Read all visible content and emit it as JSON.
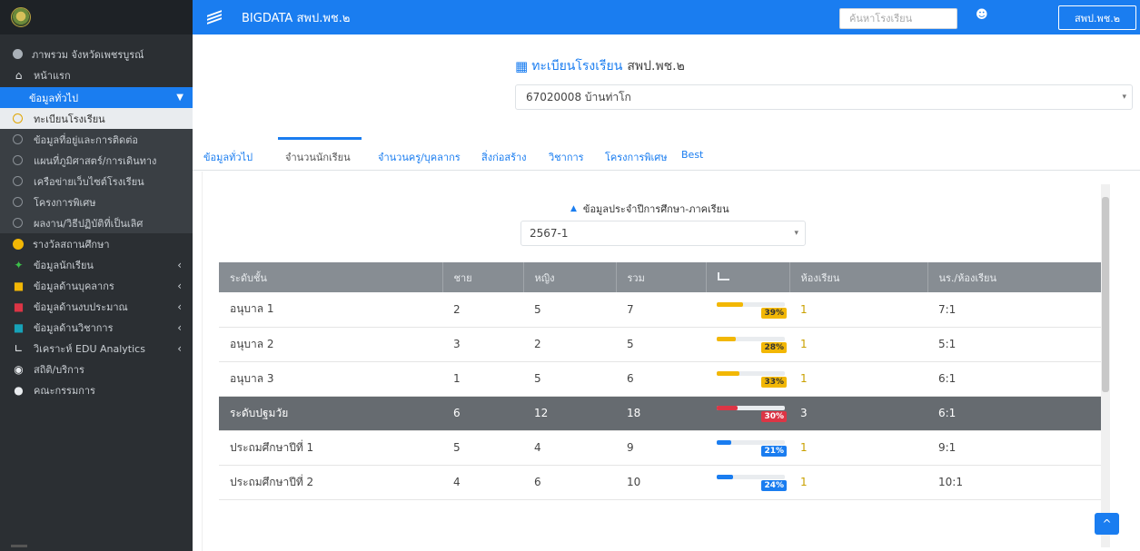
{
  "header": {
    "app_title": "BIGDATA สพป.พช.๒",
    "search_placeholder": "ค้นหาโรงเรียน",
    "user_label": "สพป.พช.๒"
  },
  "sidebar": {
    "items": [
      {
        "label": "ภาพรวม จังหวัดเพชรบูรณ์",
        "icon": "globe-icon",
        "color": "#a9b0b7"
      },
      {
        "label": "หน้าแรก",
        "icon": "home-icon",
        "color": "#dfe3e7"
      }
    ],
    "active_group": "ข้อมูลทั่วไป",
    "sub_items": [
      {
        "label": "ทะเบียนโรงเรียน",
        "current": true
      },
      {
        "label": "ข้อมูลที่อยู่และการติดต่อ"
      },
      {
        "label": "แผนที่ภูมิศาสตร์/การเดินทาง"
      },
      {
        "label": "เครือข่ายเว็บไซต์โรงเรียน"
      },
      {
        "label": "โครงการพิเศษ"
      },
      {
        "label": "ผลงาน/วิธีปฏิบัติที่เป็นเลิศ"
      }
    ],
    "groups": [
      {
        "label": "รางวัลสถานศึกษา",
        "icon": "award-icon",
        "color": "#f2b705",
        "expandable": false
      },
      {
        "label": "ข้อมูลนักเรียน",
        "icon": "student-icon",
        "color": "#3cbf4a",
        "expandable": true
      },
      {
        "label": "ข้อมูลด้านบุคลากร",
        "icon": "staff-icon",
        "color": "#f2b705",
        "expandable": true
      },
      {
        "label": "ข้อมูลด้านงบประมาณ",
        "icon": "budget-icon",
        "color": "#dc3545",
        "expandable": true
      },
      {
        "label": "ข้อมูลด้านวิชาการ",
        "icon": "academic-icon",
        "color": "#17a2b8",
        "expandable": true
      },
      {
        "label": "วิเคราะห์ EDU Analytics",
        "icon": "chart-icon",
        "color": "#e9ecef",
        "expandable": true
      },
      {
        "label": "สถิติ/บริการ",
        "icon": "eye-icon",
        "color": "#e9ecef",
        "expandable": false
      },
      {
        "label": "คณะกรรมการ",
        "icon": "users-icon",
        "color": "#e9ecef",
        "expandable": false
      }
    ]
  },
  "main": {
    "page_title_prefix": "ทะเบียนโรงเรียน",
    "page_title_suffix": "สพป.พช.๒",
    "school_selected": "67020008 บ้านท่าโก",
    "tabs": [
      "ข้อมูลทั่วไป",
      "จำนวนนักเรียน",
      "จำนวนครู/บุคลากร",
      "สิ่งก่อสร้าง",
      "วิชาการ",
      "โครงการพิเศษ",
      "Best"
    ],
    "active_tab": "จำนวนนักเรียน",
    "panel_title": "ข้อมูลประจำปีการศึกษา-ภาคเรียน",
    "term_selected": "2567-1",
    "table": {
      "headers": [
        "ระดับชั้น",
        "ชาย",
        "หญิง",
        "รวม",
        "",
        "ห้องเรียน",
        "นร./ห้องเรียน"
      ],
      "rows": [
        {
          "level": "อนุบาล 1",
          "male": "2",
          "female": "5",
          "total": "7",
          "pct": 39,
          "pct_label": "39%",
          "color": "yellow",
          "rooms": "1",
          "ratio": "7:1"
        },
        {
          "level": "อนุบาล 2",
          "male": "3",
          "female": "2",
          "total": "5",
          "pct": 28,
          "pct_label": "28%",
          "color": "yellow",
          "rooms": "1",
          "ratio": "5:1"
        },
        {
          "level": "อนุบาล 3",
          "male": "1",
          "female": "5",
          "total": "6",
          "pct": 33,
          "pct_label": "33%",
          "color": "yellow",
          "rooms": "1",
          "ratio": "6:1"
        },
        {
          "level": "ระดับปฐมวัย",
          "male": "6",
          "female": "12",
          "total": "18",
          "pct": 30,
          "pct_label": "30%",
          "color": "red",
          "rooms": "3",
          "ratio": "6:1",
          "summary": true
        },
        {
          "level": "ประถมศึกษาปีที่ 1",
          "male": "5",
          "female": "4",
          "total": "9",
          "pct": 21,
          "pct_label": "21%",
          "color": "blue",
          "rooms": "1",
          "ratio": "9:1"
        },
        {
          "level": "ประถมศึกษาปีที่ 2",
          "male": "4",
          "female": "6",
          "total": "10",
          "pct": 24,
          "pct_label": "24%",
          "color": "blue",
          "rooms": "1",
          "ratio": "10:1"
        }
      ]
    }
  }
}
